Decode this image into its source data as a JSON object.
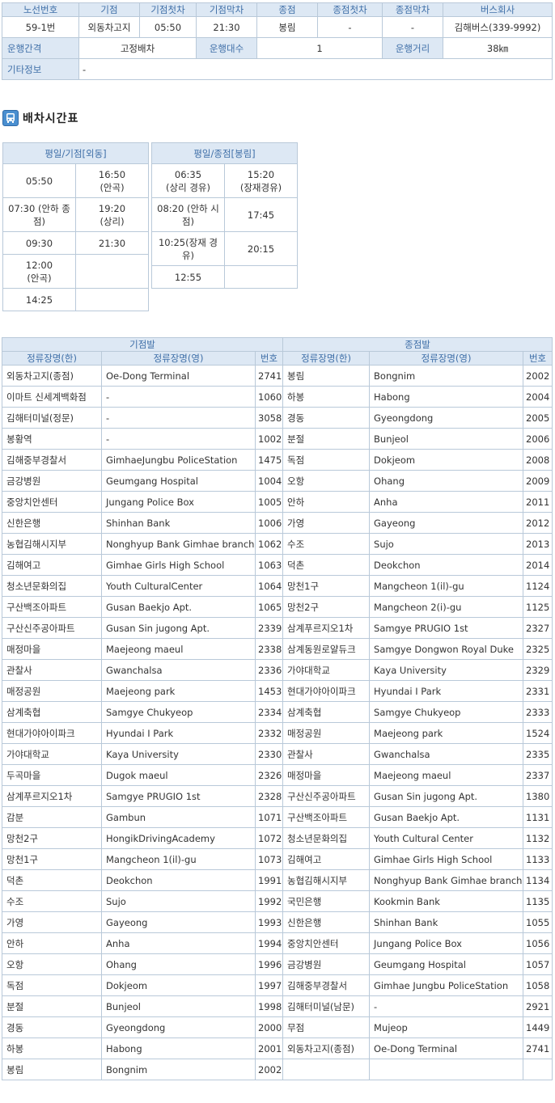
{
  "route_info": {
    "headers": [
      "노선번호",
      "기점",
      "기점첫차",
      "기점막차",
      "종점",
      "종점첫차",
      "종점막차",
      "버스회사"
    ],
    "values": [
      "59-1번",
      "외동차고지",
      "05:50",
      "21:30",
      "봉림",
      "-",
      "-",
      "김해버스(339-9992)"
    ],
    "interval_label": "운행간격",
    "interval_value": "고정배차",
    "count_label": "운행대수",
    "count_value": "1",
    "distance_label": "운행거리",
    "distance_value": "38㎞",
    "etc_label": "기타정보",
    "etc_value": "-"
  },
  "schedule": {
    "title": "배차시간표",
    "icon": "bus-icon",
    "start": {
      "header": "평일/기점[외동]",
      "rows": [
        [
          "05:50",
          "16:50\n(안곡)"
        ],
        [
          "07:30 (안하 종점)",
          "19:20\n(상리)"
        ],
        [
          "09:30",
          "21:30"
        ],
        [
          "12:00\n(안곡)",
          ""
        ],
        [
          "14:25",
          ""
        ]
      ]
    },
    "end": {
      "header": "평일/종점[봉림]",
      "rows": [
        [
          "06:35\n(상리 경유)",
          "15:20\n(장재경유)"
        ],
        [
          "08:20 (안하 시점)",
          "17:45"
        ],
        [
          "10:25(장재 경유)",
          "20:15"
        ],
        [
          "12:55",
          ""
        ]
      ]
    }
  },
  "stops": {
    "start_header": "기점발",
    "end_header": "종점발",
    "col_name_kr": "정류장명(한)",
    "col_name_en": "정류장명(영)",
    "col_num": "번호",
    "rows": [
      [
        "외동차고지(종점)",
        "Oe-Dong Terminal",
        "2741",
        "봉림",
        "Bongnim",
        "2002"
      ],
      [
        "이마트 신세계백화점",
        "-",
        "1060",
        "하봉",
        "Habong",
        "2004"
      ],
      [
        "김해터미널(정문)",
        "-",
        "3058",
        "경동",
        "Gyeongdong",
        "2005"
      ],
      [
        "봉황역",
        "-",
        "1002",
        "분절",
        "Bunjeol",
        "2006"
      ],
      [
        "김해중부경찰서",
        "GimhaeJungbu PoliceStation",
        "1475",
        "독점",
        "Dokjeom",
        "2008"
      ],
      [
        "금강병원",
        "Geumgang Hospital",
        "1004",
        "오항",
        "Ohang",
        "2009"
      ],
      [
        "중앙치안센터",
        "Jungang Police Box",
        "1005",
        "안하",
        "Anha",
        "2011"
      ],
      [
        "신한은행",
        "Shinhan Bank",
        "1006",
        "가영",
        "Gayeong",
        "2012"
      ],
      [
        "농협김해시지부",
        "Nonghyup Bank Gimhae branch",
        "1062",
        "수조",
        "Sujo",
        "2013"
      ],
      [
        "김해여고",
        "Gimhae Girls High School",
        "1063",
        "덕촌",
        "Deokchon",
        "2014"
      ],
      [
        "청소년문화의집",
        "Youth CulturalCenter",
        "1064",
        "망천1구",
        "Mangcheon 1(il)-gu",
        "1124"
      ],
      [
        "구산백조아파트",
        "Gusan Baekjo Apt.",
        "1065",
        "망천2구",
        "Mangcheon 2(i)-gu",
        "1125"
      ],
      [
        "구산신주공아파트",
        "Gusan Sin jugong Apt.",
        "2339",
        "삼계푸르지오1차",
        "Samgye PRUGIO 1st",
        "2327"
      ],
      [
        "매정마을",
        "Maejeong maeul",
        "2338",
        "삼계동원로얄듀크",
        "Samgye Dongwon Royal Duke",
        "2325"
      ],
      [
        "관찰사",
        "Gwanchalsa",
        "2336",
        "가야대학교",
        "Kaya University",
        "2329"
      ],
      [
        "매정공원",
        "Maejeong park",
        "1453",
        "현대가야아이파크",
        "Hyundai I Park",
        "2331"
      ],
      [
        "삼계축협",
        "Samgye Chukyeop",
        "2334",
        "삼계축협",
        "Samgye Chukyeop",
        "2333"
      ],
      [
        "현대가야아이파크",
        "Hyundai I Park",
        "2332",
        "매정공원",
        "Maejeong park",
        "1524"
      ],
      [
        "가야대학교",
        "Kaya University",
        "2330",
        "관찰사",
        "Gwanchalsa",
        "2335"
      ],
      [
        "두곡마을",
        "Dugok maeul",
        "2326",
        "매정마을",
        "Maejeong maeul",
        "2337"
      ],
      [
        "삼계푸르지오1차",
        "Samgye PRUGIO 1st",
        "2328",
        "구산신주공아파트",
        "Gusan Sin jugong Apt.",
        "1380"
      ],
      [
        "감분",
        "Gambun",
        "1071",
        "구산백조아파트",
        "Gusan Baekjo Apt.",
        "1131"
      ],
      [
        "망천2구",
        "HongikDrivingAcademy",
        "1072",
        "청소년문화의집",
        "Youth Cultural Center",
        "1132"
      ],
      [
        "망천1구",
        "Mangcheon 1(il)-gu",
        "1073",
        "김해여고",
        "Gimhae Girls High School",
        "1133"
      ],
      [
        "덕촌",
        "Deokchon",
        "1991",
        "농협김해시지부",
        "Nonghyup Bank Gimhae branch",
        "1134"
      ],
      [
        "수조",
        "Sujo",
        "1992",
        "국민은행",
        "Kookmin Bank",
        "1135"
      ],
      [
        "가영",
        "Gayeong",
        "1993",
        "신한은행",
        "Shinhan Bank",
        "1055"
      ],
      [
        "안하",
        "Anha",
        "1994",
        "중앙치안센터",
        "Jungang Police Box",
        "1056"
      ],
      [
        "오항",
        "Ohang",
        "1996",
        "금강병원",
        "Geumgang Hospital",
        "1057"
      ],
      [
        "독점",
        "Dokjeom",
        "1997",
        "김해중부경찰서",
        "Gimhae Jungbu PoliceStation",
        "1058"
      ],
      [
        "분절",
        "Bunjeol",
        "1998",
        "김해터미널(남문)",
        "-",
        "2921"
      ],
      [
        "경동",
        "Gyeongdong",
        "2000",
        "무점",
        "Mujeop",
        "1449"
      ],
      [
        "하봉",
        "Habong",
        "2001",
        "외동차고지(종점)",
        "Oe-Dong Terminal",
        "2741"
      ],
      [
        "봉림",
        "Bongnim",
        "2002",
        "",
        "",
        ""
      ]
    ]
  }
}
